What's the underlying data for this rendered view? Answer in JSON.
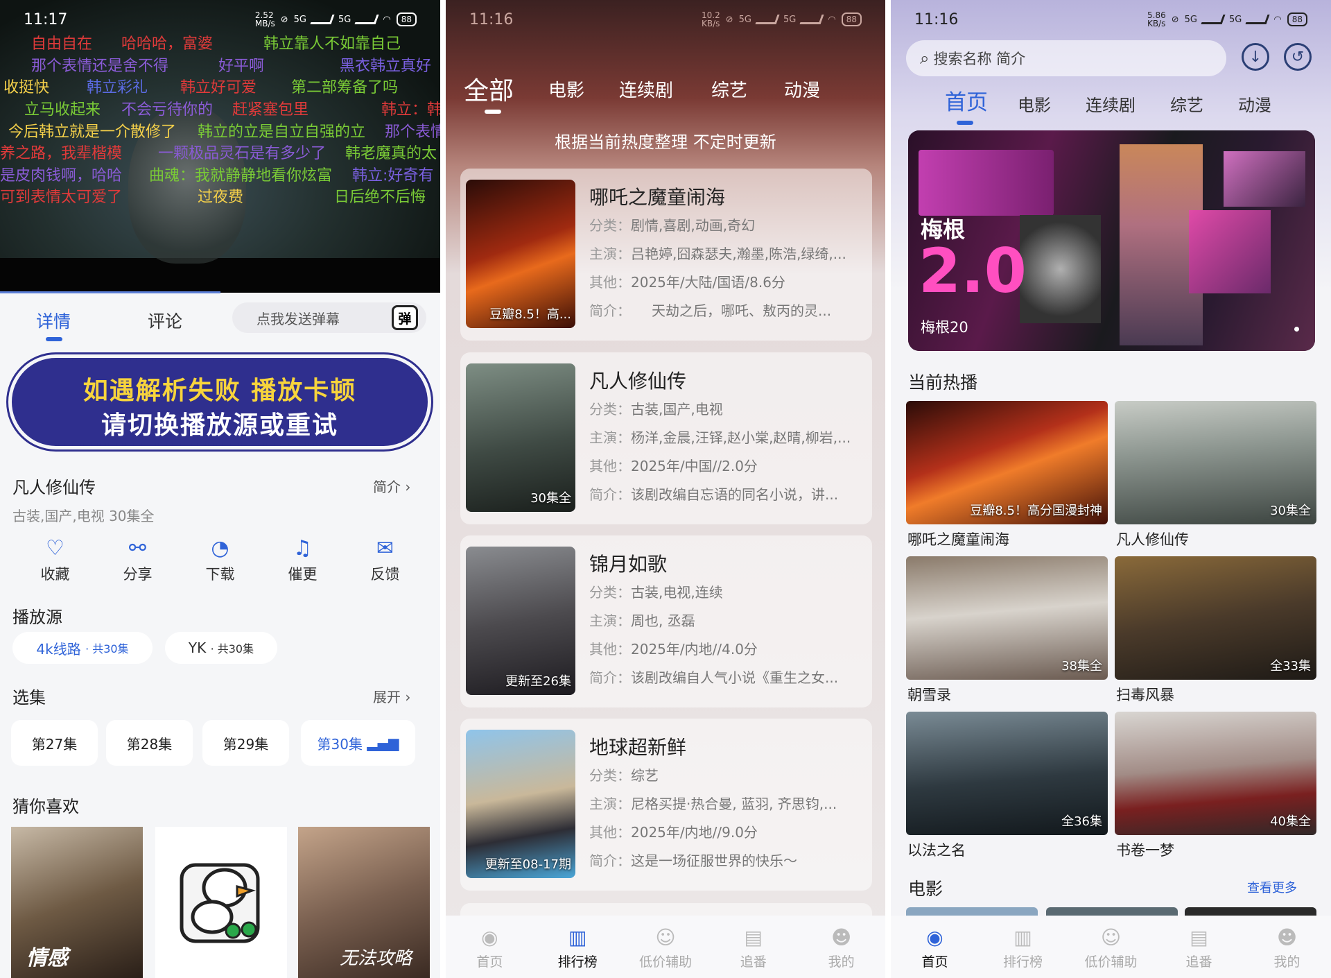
{
  "colors": {
    "accent": "#2f63d8",
    "banner_bg": "#2f2f8e",
    "banner_yellow": "#f7d43c"
  },
  "p1": {
    "status": {
      "time": "11:17",
      "speed": "2.52\nMB/s",
      "net1": "5G",
      "net2": "5G",
      "battery": "88"
    },
    "danmaku": [
      {
        "text": "自由自在",
        "color": "#e03a3a"
      },
      {
        "text": "哈哈哈，富婆",
        "color": "#e03a3a"
      },
      {
        "text": "韩立靠人不如靠自己",
        "color": "#7acb36"
      },
      {
        "text": "那个表情还是舍不得",
        "color": "#8a5bd6"
      },
      {
        "text": "好平啊",
        "color": "#8a5bd6"
      },
      {
        "text": "黑衣韩立真好",
        "color": "#7a60e0"
      },
      {
        "text": "收挺快",
        "color": "#f4d04a"
      },
      {
        "text": "韩立彩礼",
        "color": "#5a6ae0"
      },
      {
        "text": "韩立好可爱",
        "color": "#e03a3a"
      },
      {
        "text": "第二部筹备了吗",
        "color": "#7acb36"
      },
      {
        "text": "立马收起来",
        "color": "#7acb36"
      },
      {
        "text": "不会亏待你的",
        "color": "#8a5bd6"
      },
      {
        "text": "赶紧塞包里",
        "color": "#e03a3a"
      },
      {
        "text": "韩立：韩",
        "color": "#e03a3a"
      },
      {
        "text": "今后韩立就是一介散修了",
        "color": "#f4d04a"
      },
      {
        "text": "韩立的立是自立自强的立",
        "color": "#7acb36"
      },
      {
        "text": "那个表情",
        "color": "#8a5bd6"
      },
      {
        "text": "养之路，我辈楷模",
        "color": "#e03a3a"
      },
      {
        "text": "一颗极品灵石是有多少了",
        "color": "#8a5bd6"
      },
      {
        "text": "韩老魔真的太",
        "color": "#7acb36"
      },
      {
        "text": "是皮肉钱啊，哈哈",
        "color": "#8a5bd6"
      },
      {
        "text": "曲魂：我就静静地看你炫富",
        "color": "#7acb36"
      },
      {
        "text": "韩立:好奇有",
        "color": "#7a60e0"
      },
      {
        "text": "可到表情太可爱了",
        "color": "#e03a3a"
      },
      {
        "text": "过夜费",
        "color": "#f4d04a"
      },
      {
        "text": "日后绝不后悔",
        "color": "#7acb36"
      }
    ],
    "tabs": [
      "详情",
      "评论"
    ],
    "danmu_placeholder": "点我发送弹幕",
    "danmu_icon": "弹",
    "banner": {
      "line1": "如遇解析失败 播放卡顿",
      "line2": "请切换播放源或重试"
    },
    "show": {
      "title": "凡人修仙传",
      "intro_link": "简介",
      "tags": "古装,国产,电视 30集全"
    },
    "actions": [
      {
        "label": "收藏",
        "icon": "heart-icon",
        "glyph": "♡"
      },
      {
        "label": "分享",
        "icon": "share-icon",
        "glyph": "⚯"
      },
      {
        "label": "下载",
        "icon": "download-icon",
        "glyph": "◔"
      },
      {
        "label": "催更",
        "icon": "bell-icon",
        "glyph": "♫"
      },
      {
        "label": "反馈",
        "icon": "feedback-icon",
        "glyph": "✉"
      }
    ],
    "source": {
      "heading": "播放源",
      "items": [
        {
          "name": "4k线路",
          "count": "· 共30集"
        },
        {
          "name": "YK",
          "count": "· 共30集"
        }
      ]
    },
    "episodes": {
      "heading": "选集",
      "expand": "展开",
      "items": [
        "第27集",
        "第28集",
        "第29集",
        "第30集"
      ]
    },
    "recommend": {
      "heading": "猜你喜欢",
      "posters": [
        "情感",
        " ",
        "无法攻略"
      ]
    }
  },
  "p2": {
    "status": {
      "time": "11:16",
      "speed": "10.2\nKB/s",
      "net1": "5G",
      "net2": "5G",
      "battery": "88"
    },
    "tabs": [
      "全部",
      "电影",
      "连续剧",
      "综艺",
      "动漫"
    ],
    "note": "根据当前热度整理 不定时更新",
    "labels": {
      "cat": "分类：",
      "cast": "主演：",
      "other": "其他：",
      "intro": "简介："
    },
    "cards": [
      {
        "title": "哪吒之魔童闹海",
        "badge": "豆瓣8.5！高...",
        "cat": "剧情,喜剧,动画,奇幻",
        "cast": "吕艳婷,囧森瑟夫,瀚墨,陈浩,绿绮,...",
        "other": "2025年/大陆/国语/8.6分",
        "intro": "　　天劫之后，哪吒、敖丙的灵...",
        "grad": "linear-gradient(160deg,#2a0c08,#a02a10 45%,#e86a1c 60%,#3a0d06)"
      },
      {
        "title": "凡人修仙传",
        "badge": "30集全",
        "cat": "古装,国产,电视",
        "cast": "杨洋,金晨,汪铎,赵小棠,赵晴,柳岩,...",
        "other": "2025年/中国//2.0分",
        "intro": "该剧改编自忘语的同名小说，讲...",
        "grad": "linear-gradient(170deg,#7e8e84,#3f4a44 55%,#1a1f1c)"
      },
      {
        "title": "锦月如歌",
        "badge": "更新至26集",
        "cat": "古装,电视,连续",
        "cast": "周也, 丞磊",
        "other": "2025年/内地//4.0分",
        "intro": "该剧改编自人气小说《重生之女...",
        "grad": "linear-gradient(170deg,#8a8c90,#4c4a4e 50%,#1d1b20)"
      },
      {
        "title": "地球超新鲜",
        "badge": "更新至08-17期",
        "cat": "综艺",
        "cast": "尼格买提·热合曼, 蓝羽, 齐思钧,...",
        "other": "2025年/内地//9.0分",
        "intro": "这是一场征服世界的快乐～",
        "grad": "linear-gradient(170deg,#8fc4ea,#c9b89a 45%,#2d2d35 70%,#4aa6d8)"
      }
    ],
    "nav": [
      {
        "label": "首页",
        "icon": "home-icon",
        "glyph": "◉"
      },
      {
        "label": "排行榜",
        "icon": "chart-icon",
        "glyph": "▥"
      },
      {
        "label": "低价辅助",
        "icon": "assist-icon",
        "glyph": "☺"
      },
      {
        "label": "追番",
        "icon": "follow-icon",
        "glyph": "▤"
      },
      {
        "label": "我的",
        "icon": "profile-icon",
        "glyph": "☻"
      }
    ]
  },
  "p3": {
    "status": {
      "time": "11:16",
      "speed": "5.86\nKB/s",
      "net1": "5G",
      "net2": "5G",
      "battery": "88"
    },
    "search_placeholder": "搜索名称 简介",
    "tabs": [
      "首页",
      "电影",
      "连续剧",
      "综艺",
      "动漫"
    ],
    "hero": {
      "title_cn": "梅根",
      "title_num": "2.0",
      "caption": "梅根20"
    },
    "hot_heading": "当前热播",
    "tiles": [
      {
        "name": "哪吒之魔童闹海",
        "badge": "豆瓣8.5！高分国漫封神",
        "grad": "linear-gradient(160deg,#2a0c08,#b3301a 40%,#f07c2a 55%,#400f08)"
      },
      {
        "name": "凡人修仙传",
        "badge": "30集全",
        "grad": "linear-gradient(175deg,#c8ccc6,#8d9690 40%,#3c4440)"
      },
      {
        "name": "朝雪录",
        "badge": "38集全",
        "grad": "linear-gradient(175deg,#8a7a6a,#d8d3cc 45%,#6a5a50)"
      },
      {
        "name": "扫毒风暴",
        "badge": "全33集",
        "grad": "linear-gradient(170deg,#8a6a3a,#4a3a2a 50%,#1e1a16)"
      },
      {
        "name": "以法之名",
        "badge": "全36集",
        "grad": "linear-gradient(175deg,#7a8b95,#2e3940 55%,#12181c)"
      },
      {
        "name": "书卷一梦",
        "badge": "40集全",
        "grad": "linear-gradient(175deg,#d9d6d2,#a28c86 45%,#7a2020 70%,#302828)"
      }
    ],
    "movie_heading": "电影",
    "more": "查看更多",
    "nav": [
      {
        "label": "首页",
        "icon": "home-icon",
        "glyph": "◉"
      },
      {
        "label": "排行榜",
        "icon": "chart-icon",
        "glyph": "▥"
      },
      {
        "label": "低价辅助",
        "icon": "assist-icon",
        "glyph": "☺"
      },
      {
        "label": "追番",
        "icon": "follow-icon",
        "glyph": "▤"
      },
      {
        "label": "我的",
        "icon": "profile-icon",
        "glyph": "☻"
      }
    ]
  }
}
